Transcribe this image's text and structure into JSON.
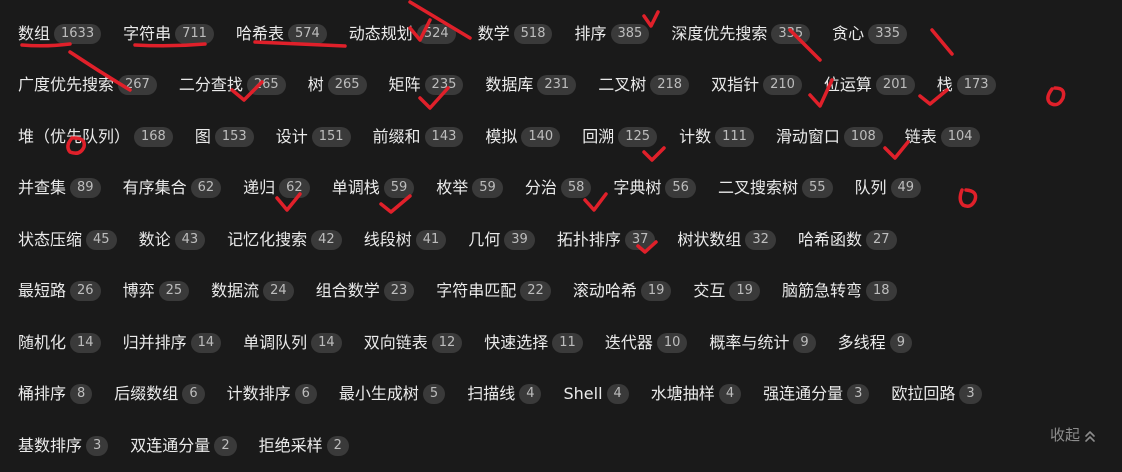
{
  "rows": [
    [
      {
        "label": "数组",
        "count": "1633"
      },
      {
        "label": "字符串",
        "count": "711"
      },
      {
        "label": "哈希表",
        "count": "574"
      },
      {
        "label": "动态规划",
        "count": "524"
      },
      {
        "label": "数学",
        "count": "518"
      },
      {
        "label": "排序",
        "count": "385"
      },
      {
        "label": "深度优先搜索",
        "count": "335"
      },
      {
        "label": "贪心",
        "count": "335"
      }
    ],
    [
      {
        "label": "广度优先搜索",
        "count": "267"
      },
      {
        "label": "二分查找",
        "count": "265"
      },
      {
        "label": "树",
        "count": "265"
      },
      {
        "label": "矩阵",
        "count": "235"
      },
      {
        "label": "数据库",
        "count": "231"
      },
      {
        "label": "二叉树",
        "count": "218"
      },
      {
        "label": "双指针",
        "count": "210"
      },
      {
        "label": "位运算",
        "count": "201"
      },
      {
        "label": "栈",
        "count": "173"
      }
    ],
    [
      {
        "label": "堆（优先队列）",
        "count": "168"
      },
      {
        "label": "图",
        "count": "153"
      },
      {
        "label": "设计",
        "count": "151"
      },
      {
        "label": "前缀和",
        "count": "143"
      },
      {
        "label": "模拟",
        "count": "140"
      },
      {
        "label": "回溯",
        "count": "125"
      },
      {
        "label": "计数",
        "count": "111"
      },
      {
        "label": "滑动窗口",
        "count": "108"
      },
      {
        "label": "链表",
        "count": "104"
      }
    ],
    [
      {
        "label": "并查集",
        "count": "89"
      },
      {
        "label": "有序集合",
        "count": "62"
      },
      {
        "label": "递归",
        "count": "62"
      },
      {
        "label": "单调栈",
        "count": "59"
      },
      {
        "label": "枚举",
        "count": "59"
      },
      {
        "label": "分治",
        "count": "58"
      },
      {
        "label": "字典树",
        "count": "56"
      },
      {
        "label": "二叉搜索树",
        "count": "55"
      },
      {
        "label": "队列",
        "count": "49"
      }
    ],
    [
      {
        "label": "状态压缩",
        "count": "45"
      },
      {
        "label": "数论",
        "count": "43"
      },
      {
        "label": "记忆化搜索",
        "count": "42"
      },
      {
        "label": "线段树",
        "count": "41"
      },
      {
        "label": "几何",
        "count": "39"
      },
      {
        "label": "拓扑排序",
        "count": "37"
      },
      {
        "label": "树状数组",
        "count": "32"
      },
      {
        "label": "哈希函数",
        "count": "27"
      }
    ],
    [
      {
        "label": "最短路",
        "count": "26"
      },
      {
        "label": "博弈",
        "count": "25"
      },
      {
        "label": "数据流",
        "count": "24"
      },
      {
        "label": "组合数学",
        "count": "23"
      },
      {
        "label": "字符串匹配",
        "count": "22"
      },
      {
        "label": "滚动哈希",
        "count": "19"
      },
      {
        "label": "交互",
        "count": "19"
      },
      {
        "label": "脑筋急转弯",
        "count": "18"
      }
    ],
    [
      {
        "label": "随机化",
        "count": "14"
      },
      {
        "label": "归并排序",
        "count": "14"
      },
      {
        "label": "单调队列",
        "count": "14"
      },
      {
        "label": "双向链表",
        "count": "12"
      },
      {
        "label": "快速选择",
        "count": "11"
      },
      {
        "label": "迭代器",
        "count": "10"
      },
      {
        "label": "概率与统计",
        "count": "9"
      },
      {
        "label": "多线程",
        "count": "9"
      }
    ],
    [
      {
        "label": "桶排序",
        "count": "8"
      },
      {
        "label": "后缀数组",
        "count": "6"
      },
      {
        "label": "计数排序",
        "count": "6"
      },
      {
        "label": "最小生成树",
        "count": "5"
      },
      {
        "label": "扫描线",
        "count": "4"
      },
      {
        "label": "Shell",
        "count": "4"
      },
      {
        "label": "水塘抽样",
        "count": "4"
      },
      {
        "label": "强连通分量",
        "count": "3"
      },
      {
        "label": "欧拉回路",
        "count": "3"
      }
    ],
    [
      {
        "label": "基数排序",
        "count": "3"
      },
      {
        "label": "双连通分量",
        "count": "2"
      },
      {
        "label": "拒绝采样",
        "count": "2"
      }
    ]
  ],
  "collapse": {
    "label": "收起",
    "icon": "double-chevron-up-icon"
  },
  "colors": {
    "background": "#1a1a1a",
    "badge": "#3a3a3a",
    "annotation": "#e0202a"
  }
}
